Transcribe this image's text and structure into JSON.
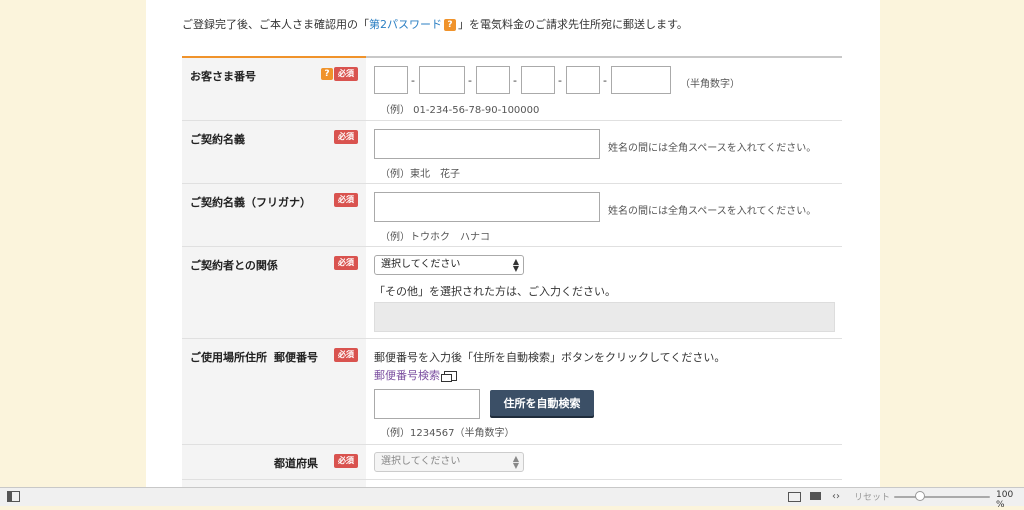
{
  "intro": {
    "prefix": "ご登録完了後、ご本人さま確認用の「",
    "link": "第2パスワード",
    "qmark": "?",
    "suffix": "」を電気料金のご請求先住所宛に郵送します。"
  },
  "required_label": "必須",
  "question_icon": "?",
  "rows": {
    "customer_number": {
      "label": "お客さま番号",
      "dash": "-",
      "note": "（半角数字）",
      "example": "（例） 01-234-56-78-90-100000"
    },
    "contract_name": {
      "label": "ご契約名義",
      "note": "姓名の間には全角スペースを入れてください。",
      "example": "（例）東北　花子"
    },
    "contract_kana": {
      "label": "ご契約名義（フリガナ）",
      "note": "姓名の間には全角スペースを入れてください。",
      "example": "（例）トウホク　ハナコ"
    },
    "relation": {
      "label": "ご契約者との関係",
      "select_value": "選択してください",
      "other_text": "「その他」を選択された方は、ご入力ください。"
    },
    "postal": {
      "label": "ご使用場所住所",
      "sub_label": "郵便番号",
      "instruction": "郵便番号を入力後「住所を自動検索」ボタンをクリックしてください。",
      "search_link": "郵便番号検索",
      "button": "住所を自動検索",
      "example": "（例）1234567（半角数字）"
    },
    "prefecture": {
      "sub_label": "都道府県",
      "select_value": "選択してください"
    }
  },
  "statusbar": {
    "reset": "リセット",
    "zoom": "100 %"
  }
}
